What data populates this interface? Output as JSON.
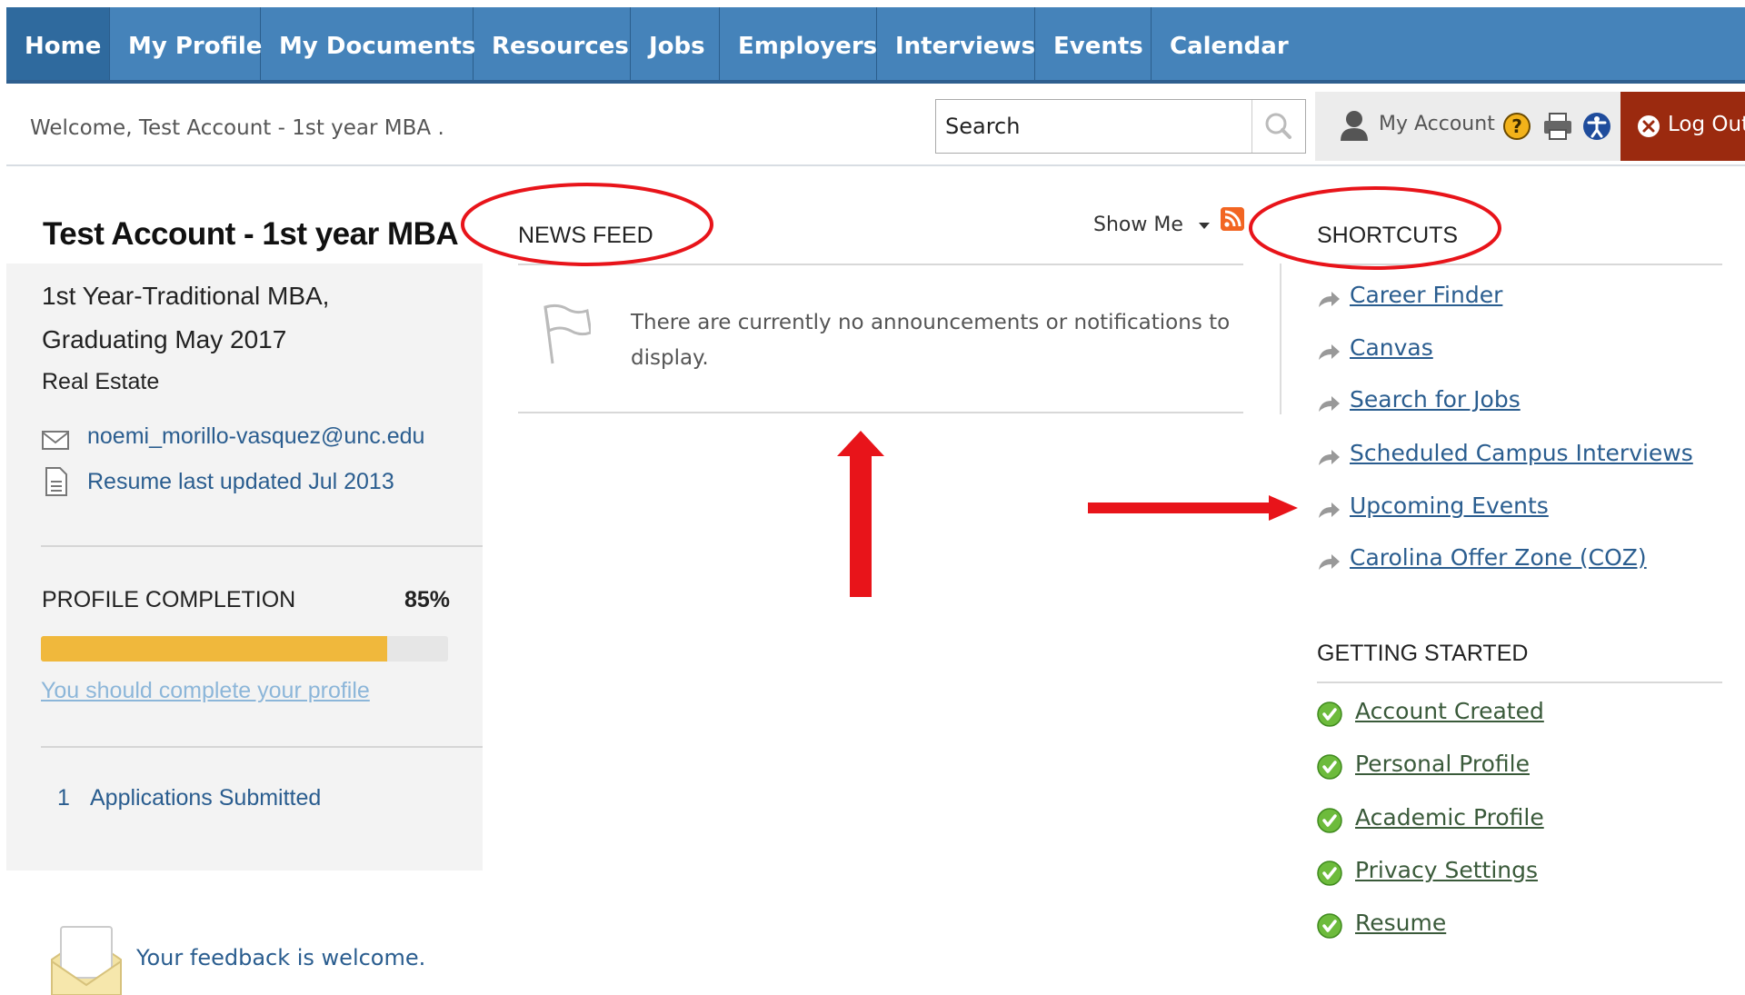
{
  "nav": {
    "items": [
      {
        "label": "Home",
        "active": true
      },
      {
        "label": "My Profile"
      },
      {
        "label": "My Documents"
      },
      {
        "label": "Resources"
      },
      {
        "label": "Jobs"
      },
      {
        "label": "Employers"
      },
      {
        "label": "Interviews"
      },
      {
        "label": "Events"
      },
      {
        "label": "Calendar"
      }
    ]
  },
  "header": {
    "welcome": "Welcome, Test Account - 1st year MBA .",
    "search_value": "Search",
    "my_account": "My Account",
    "logout": "Log Out"
  },
  "profile": {
    "name": "Test Account - 1st year MBA",
    "program": "1st Year-Traditional MBA,",
    "graduation": "Graduating May 2017",
    "concentration": "Real Estate",
    "email": "noemi_morillo-vasquez@unc.edu",
    "resume": "Resume last updated Jul 2013",
    "completion_label": "PROFILE COMPLETION",
    "completion_value": "85%",
    "completion_fraction": 0.85,
    "complete_link": "You should complete your profile",
    "applications_count": "1",
    "applications_label": "Applications Submitted",
    "feedback": "Your feedback is welcome."
  },
  "news_feed": {
    "title": "NEWS FEED",
    "show_me": "Show Me",
    "empty_message": "There are currently no announcements or notifications to display."
  },
  "shortcuts": {
    "title": "SHORTCUTS",
    "items": [
      "Career Finder",
      "Canvas",
      "Search for Jobs",
      "Scheduled Campus Interviews",
      "Upcoming Events",
      "Carolina Offer Zone (COZ)"
    ]
  },
  "getting_started": {
    "title": "GETTING STARTED",
    "items": [
      "Account Created",
      "Personal Profile",
      "Academic Profile",
      "Privacy Settings",
      "Resume"
    ]
  },
  "colors": {
    "nav_bg": "#4583ba",
    "logout_bg": "#9b2a0f",
    "progress_fill": "#f0b83c",
    "link": "#2a5d8f",
    "annotation_red": "#e8141a",
    "check_green": "#6dbb3c"
  },
  "icons": [
    "search-icon",
    "user-icon",
    "help-icon",
    "print-icon",
    "accessibility-icon",
    "close-icon",
    "envelope-icon",
    "document-icon",
    "flag-icon",
    "rss-icon",
    "share-arrow-icon",
    "check-circle-icon",
    "mail-envelope-icon"
  ]
}
